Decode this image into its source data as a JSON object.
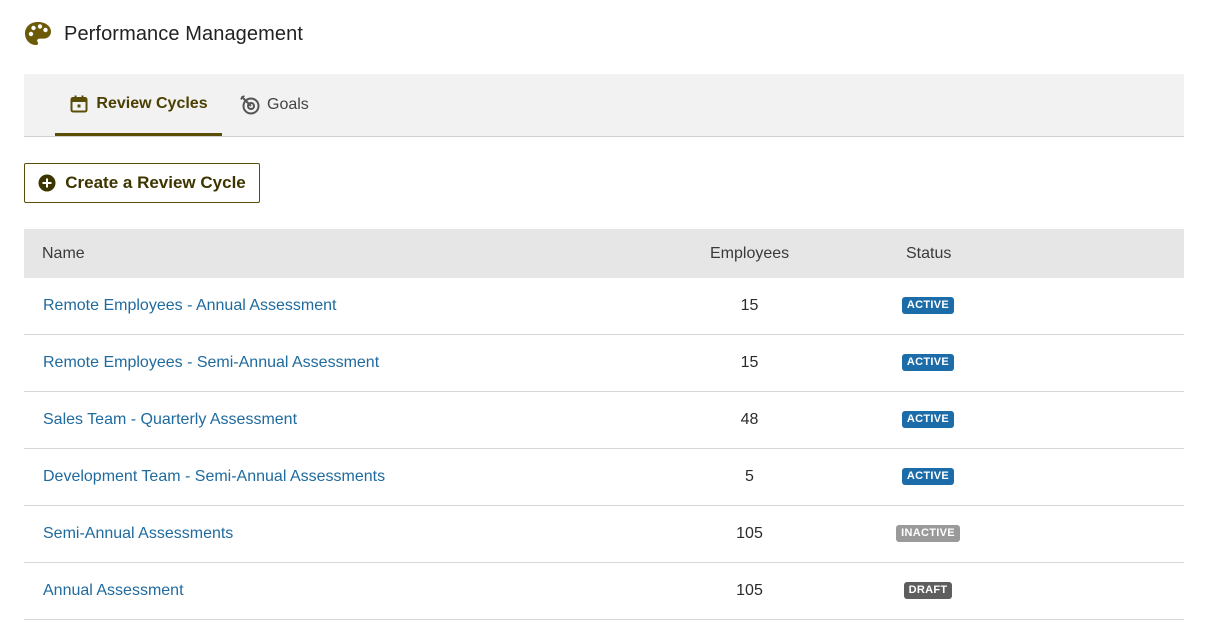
{
  "header": {
    "title": "Performance Management",
    "logo_icon": "palette-icon"
  },
  "tabs": [
    {
      "label": "Review Cycles",
      "icon": "calendar-icon",
      "active": true
    },
    {
      "label": "Goals",
      "icon": "target-icon",
      "active": false
    }
  ],
  "create_button": {
    "label": "Create a Review Cycle",
    "icon": "plus-circle-icon"
  },
  "table": {
    "columns": {
      "name": "Name",
      "employees": "Employees",
      "status": "Status"
    },
    "rows": [
      {
        "name": "Remote Employees - Annual Assessment",
        "employees": "15",
        "status": "ACTIVE"
      },
      {
        "name": "Remote Employees - Semi-Annual Assessment",
        "employees": "15",
        "status": "ACTIVE"
      },
      {
        "name": "Sales Team - Quarterly Assessment",
        "employees": "48",
        "status": "ACTIVE"
      },
      {
        "name": "Development Team - Semi-Annual Assessments",
        "employees": "5",
        "status": "ACTIVE"
      },
      {
        "name": "Semi-Annual Assessments",
        "employees": "105",
        "status": "INACTIVE"
      },
      {
        "name": "Annual Assessment",
        "employees": "105",
        "status": "DRAFT"
      }
    ]
  },
  "colors": {
    "accent": "#5a4d06",
    "link": "#1f6a9e",
    "active": "#1b6ca8",
    "inactive": "#9a9a9a",
    "draft": "#5e5e5e"
  }
}
